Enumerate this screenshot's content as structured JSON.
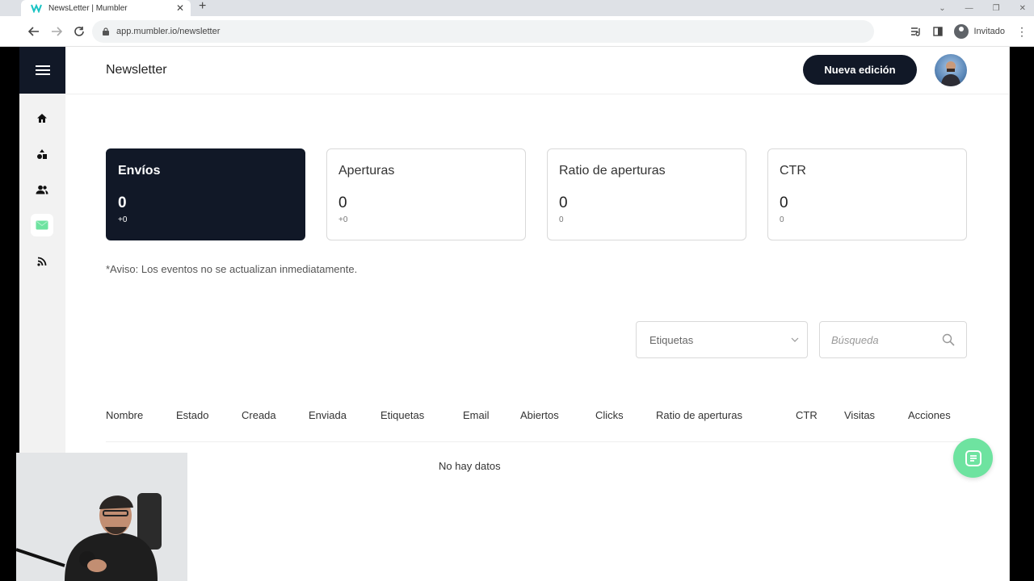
{
  "browser": {
    "tab_title": "NewsLetter | Mumbler",
    "url": "app.mumbler.io/newsletter",
    "profile_label": "Invitado"
  },
  "header": {
    "title": "Newsletter",
    "new_button": "Nueva edición"
  },
  "sidebar": {
    "items": [
      {
        "icon": "home-icon"
      },
      {
        "icon": "shapes-icon"
      },
      {
        "icon": "users-icon"
      },
      {
        "icon": "mail-icon",
        "active": true
      },
      {
        "icon": "rss-icon"
      }
    ]
  },
  "stats": [
    {
      "title": "Envíos",
      "value": "0",
      "delta": "+0"
    },
    {
      "title": "Aperturas",
      "value": "0",
      "delta": "+0"
    },
    {
      "title": "Ratio de aperturas",
      "value": "0",
      "delta": "0"
    },
    {
      "title": "CTR",
      "value": "0",
      "delta": "0"
    }
  ],
  "notice": "*Aviso: Los eventos no se actualizan inmediatamente.",
  "filters": {
    "tags_placeholder": "Etiquetas",
    "search_placeholder": "Búsqueda"
  },
  "table": {
    "columns": [
      "Nombre",
      "Estado",
      "Creada",
      "Enviada",
      "Etiquetas",
      "Email",
      "Abiertos",
      "Clicks",
      "Ratio de aperturas",
      "CTR",
      "Visitas",
      "Acciones"
    ],
    "empty_text": "No hay datos"
  },
  "colors": {
    "primary_dark": "#111827",
    "accent_green": "#6ee3a0",
    "sidebar_bg": "#f2f2f2"
  }
}
